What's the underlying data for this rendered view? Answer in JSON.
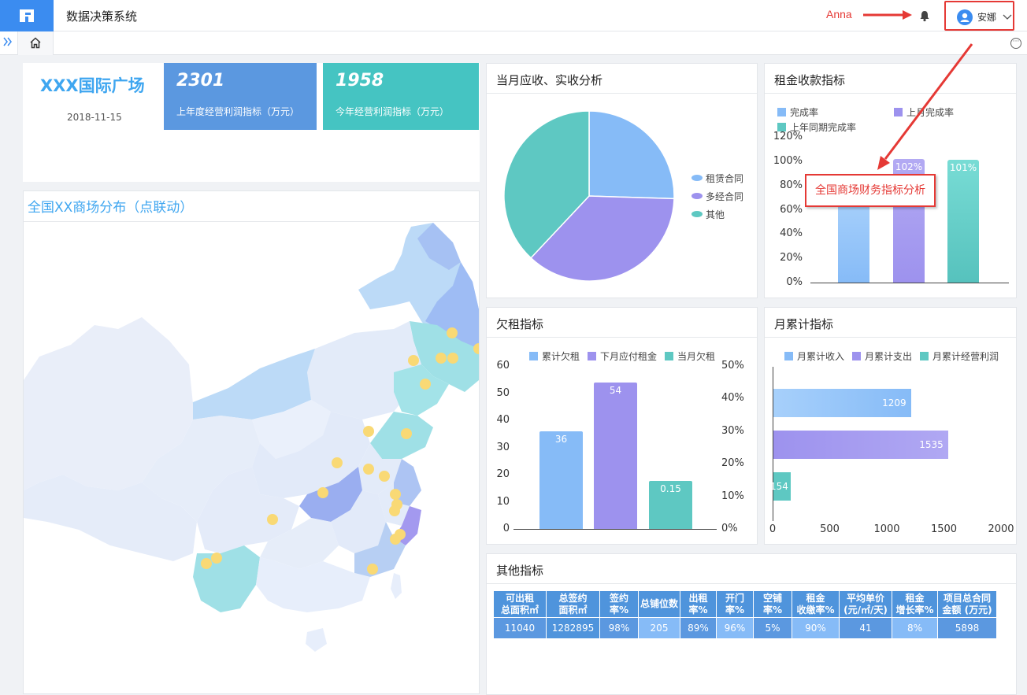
{
  "header": {
    "app_title": "数据决策系统",
    "annotation": "Anna",
    "user": "安娜",
    "accent": "#3b8cf0"
  },
  "icons": [
    "logo-icon",
    "bell-icon",
    "user-icon",
    "chevron-down-icon",
    "double-chevron-icon",
    "home-icon",
    "more-icon"
  ],
  "summary": {
    "plaza_name": "XXX国际广场",
    "date": "2018-11-15",
    "kpi1": {
      "value": "2301",
      "label": "上年度经营利润指标（万元）"
    },
    "kpi2": {
      "value": "1958",
      "label": "今年经营利润指标（万元）"
    }
  },
  "map_panel": {
    "title": "全国XX商场分布（点联动）"
  },
  "callout": "全国商场财务指标分析",
  "colors": {
    "blue": "#86bbf7",
    "purple": "#9d92ee",
    "teal": "#5ec8c2",
    "header_blue": "#4f94dc",
    "red": "#e53935"
  },
  "chart_data": [
    {
      "type": "pie",
      "title": "当月应收、实收分析",
      "series": [
        {
          "name": "租赁合同",
          "value": 25.5
        },
        {
          "name": "多经合同",
          "value": 36.5
        },
        {
          "name": "其他",
          "value": 38
        }
      ]
    },
    {
      "type": "bar",
      "title": "租金收款指标",
      "legend": [
        "完成率",
        "上月完成率",
        "上年同期完成率"
      ],
      "categories": [
        "完成率",
        "上月完成率",
        "上年同期完成率"
      ],
      "values": [
        70,
        102,
        101
      ],
      "data_labels": [
        "",
        "102%",
        "101%"
      ],
      "yticks": [
        "0%",
        "20%",
        "40%",
        "60%",
        "80%",
        "100%",
        "120%"
      ],
      "ylim": [
        0,
        120
      ]
    },
    {
      "type": "bar",
      "title": "欠租指标",
      "legend": [
        "累计欠租",
        "下月应付租金",
        "当月欠租"
      ],
      "categories": [
        "累计欠租",
        "下月应付租金",
        "当月欠租"
      ],
      "values": [
        36,
        54,
        0.15
      ],
      "data_labels": [
        "36",
        "54",
        "0.15"
      ],
      "yticks_left": [
        "0",
        "10",
        "20",
        "30",
        "40",
        "50",
        "60"
      ],
      "yticks_right": [
        "0%",
        "10%",
        "20%",
        "30%",
        "40%",
        "50%"
      ],
      "ylim": [
        0,
        60
      ],
      "y2lim": [
        0,
        50
      ]
    },
    {
      "type": "bar",
      "orientation": "horizontal",
      "title": "月累计指标",
      "legend": [
        "月累计收入",
        "月累计支出",
        "月累计经营利润"
      ],
      "categories": [
        "月累计收入",
        "月累计支出",
        "月累计经营利润"
      ],
      "values": [
        1209,
        1535,
        154
      ],
      "data_labels": [
        "1209",
        "1535",
        "154"
      ],
      "xticks": [
        "0",
        "500",
        "1000",
        "1500",
        "2000"
      ],
      "xlim": [
        0,
        2000
      ]
    },
    {
      "type": "table",
      "title": "其他指标",
      "columns": [
        "可出租总面积㎡",
        "总签约面积㎡",
        "签约率%",
        "总铺位数",
        "出租率%",
        "开门率%",
        "空铺率%",
        "租金收缴率%",
        "平均单价(元/㎡/天)",
        "租金增长率%",
        "项目总合同金额 (万元)"
      ],
      "header_lines": [
        [
          "可出租",
          "总面积㎡"
        ],
        [
          "总签约",
          "面积㎡"
        ],
        [
          "签约",
          "率%"
        ],
        [
          "总铺位数"
        ],
        [
          "出租",
          "率%"
        ],
        [
          "开门",
          "率%"
        ],
        [
          "空铺",
          "率%"
        ],
        [
          "租金",
          "收缴率%"
        ],
        [
          "平均单价",
          "(元/㎡/天)"
        ],
        [
          "租金",
          "增长率%"
        ],
        [
          "项目总合同",
          "金额 (万元)"
        ]
      ],
      "rows": [
        [
          "11040",
          "1282895",
          "98%",
          "205",
          "89%",
          "96%",
          "5%",
          "90%",
          "41",
          "8%",
          "5898"
        ]
      ]
    }
  ]
}
